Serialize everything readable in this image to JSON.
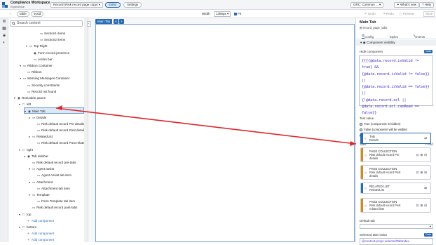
{
  "app": {
    "title": "Compliance Workspace",
    "subtitle": "Experience"
  },
  "header": {
    "record_select": "Record (Risk record page copy)",
    "editor_pill": "Editor",
    "settings_pill": "Settings",
    "scope_select": "GRC: Common ...",
    "whats_new": "What's new",
    "help": "Help"
  },
  "toolbar": {
    "table_chip": "table",
    "sysid_chip": "sysid",
    "width_label": "Width",
    "width_value": "1366px",
    "fit_label": "Fit",
    "undo": "Undo",
    "redo": "Redo",
    "preview": "Preview",
    "save": "Save"
  },
  "left_icons": [
    "layers-icon",
    "component-icon",
    "data-icon",
    "theme-icon"
  ],
  "tree": {
    "search_placeholder": "Search content",
    "rows": [
      {
        "car": "",
        "ic": "▭",
        "label": "Section1 items"
      },
      {
        "car": "",
        "ic": "▭",
        "label": "Section2 items"
      },
      {
        "car": "▾",
        "ic": "▭",
        "label": "Top Right"
      },
      {
        "car": "",
        "ic": "◉",
        "label": "Form record presence"
      },
      {
        "car": "",
        "ic": "▭",
        "label": "Action bar"
      },
      {
        "car": "▾",
        "ic": "▭",
        "label": "Ribbon Container"
      },
      {
        "car": "",
        "ic": "▭",
        "label": "Ribbon"
      },
      {
        "car": "▾",
        "ic": "▭",
        "label": "Warning Messages Container"
      },
      {
        "car": "",
        "ic": "▭",
        "label": "Security constraints"
      },
      {
        "car": "",
        "ic": "▭",
        "label": "Record not found"
      },
      {
        "car": "▾",
        "ic": "◉",
        "label": "Resizable panes"
      },
      {
        "car": "▾",
        "ic": "□",
        "label": "left"
      },
      {
        "car": "▾",
        "ic": "◉",
        "label": "Main Tab"
      },
      {
        "car": "▸",
        "ic": "▭",
        "label": "Details"
      },
      {
        "car": "",
        "ic": "▭",
        "label": "Risk default record Pre details"
      },
      {
        "car": "",
        "ic": "▭",
        "label": "Risk default record Post details"
      },
      {
        "car": "▸",
        "ic": "▭",
        "label": "RelatedList"
      },
      {
        "car": "",
        "ic": "▭",
        "label": "Risk default record Post related lists"
      },
      {
        "car": "▾",
        "ic": "□",
        "label": "right"
      },
      {
        "car": "▾",
        "ic": "◉",
        "label": "Tab sidebar"
      },
      {
        "car": "",
        "ic": "▭",
        "label": "Risk default record pre-tabs"
      },
      {
        "car": "▾",
        "ic": "▭",
        "label": "Agent assist"
      },
      {
        "car": "",
        "ic": "▭",
        "label": "Agent Assist tab item"
      },
      {
        "car": "▾",
        "ic": "▭",
        "label": "Attachment"
      },
      {
        "car": "",
        "ic": "▭",
        "label": "Attachment tab item"
      },
      {
        "car": "▾",
        "ic": "▭",
        "label": "Template"
      },
      {
        "car": "",
        "ic": "▭",
        "label": "Form Template tab item"
      },
      {
        "car": "",
        "ic": "▭",
        "label": "Risk default record post-tabs"
      },
      {
        "car": "▾",
        "ic": "□",
        "label": "top"
      },
      {
        "car": "",
        "ic": "+",
        "label": "Add component"
      },
      {
        "car": "▾",
        "ic": "□",
        "label": "bottom"
      },
      {
        "car": "",
        "ic": "+",
        "label": "Add component"
      },
      {
        "car": "",
        "ic": "+",
        "label": "Add component"
      }
    ]
  },
  "canvas": {
    "chip": "Main Tab"
  },
  "panel": {
    "title": "Main Tab",
    "subtitle": "record_page_tabs",
    "tabs": [
      "Config",
      "Styles",
      "Events"
    ],
    "section": "Component visibility",
    "hide_label": "Hide component",
    "data_badge": "Data",
    "code_lines": [
      "{{{{@data.record.isValid != true} &&",
      "{@data.record.isValid != false}} ||",
      "{@data.record.isValid == false}} ||",
      "{!@data.record.acl ||",
      "@data.record.acl.canRead == false}}"
    ],
    "test_label": "Test value",
    "radios": [
      "True (component is hidden)",
      "False (component will be visible)",
      "None"
    ],
    "tabs_label": "Tabs",
    "add_label": "+ Add",
    "cards": [
      {
        "t1": "TAB",
        "t2": [
          "Details"
        ],
        "color": "#2a6bb1"
      },
      {
        "t1": "PAGE COLLECTION",
        "t2": [
          "Risk default record Pre",
          "details"
        ],
        "color": "#d4891a"
      },
      {
        "t1": "PAGE COLLECTION",
        "t2": [
          "Risk default record Post",
          "details"
        ],
        "color": "#d4891a"
      },
      {
        "t1": "RELATED LIST",
        "t2": [
          "RelatedList"
        ],
        "color": "#2a6bb1"
      },
      {
        "t1": "PAGE COLLECTION",
        "t2": [
          "Risk default record Post",
          "related lists"
        ],
        "color": "#d4891a"
      }
    ],
    "default_tab_label": "Default tab",
    "selected_index_label": "Selected tabs index",
    "selected_index_value": "@context.props.selectedTabIndex"
  },
  "colors": {
    "accent": "#2a6bb1",
    "annotation": "#e0262a",
    "tree_selected": "#dbe8f6",
    "page_collection": "#d4891a"
  }
}
